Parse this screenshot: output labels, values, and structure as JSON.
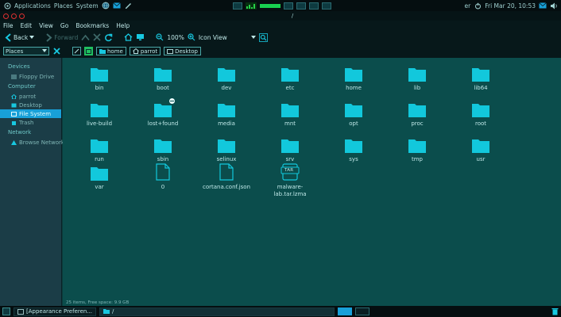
{
  "top_panel": {
    "applications": "Applications",
    "places": "Places",
    "system": "System",
    "user_short": "er",
    "datetime": "Fri Mar 20, 10:53"
  },
  "window": {
    "title": "/"
  },
  "menu": [
    "File",
    "Edit",
    "View",
    "Go",
    "Bookmarks",
    "Help"
  ],
  "toolbar": {
    "back": "Back",
    "forward": "Forward",
    "zoom": "100%",
    "view_mode": "Icon View"
  },
  "location": {
    "places_label": "Places",
    "crumbs": [
      "home",
      "parrot",
      "Desktop"
    ]
  },
  "sidebar": {
    "sections": [
      {
        "title": "Devices",
        "items": [
          {
            "label": "Floppy Drive",
            "icon": "floppy-icon",
            "active": false
          }
        ]
      },
      {
        "title": "Computer",
        "items": [
          {
            "label": "parrot",
            "icon": "home-icon",
            "active": false
          },
          {
            "label": "Desktop",
            "icon": "desktop-icon",
            "active": false
          },
          {
            "label": "File System",
            "icon": "drive-icon",
            "active": true
          },
          {
            "label": "Trash",
            "icon": "trash-icon",
            "active": false
          }
        ]
      },
      {
        "title": "Network",
        "items": [
          {
            "label": "Browse Network",
            "icon": "network-icon",
            "active": false
          }
        ]
      }
    ]
  },
  "files": [
    {
      "name": "bin",
      "type": "folder"
    },
    {
      "name": "boot",
      "type": "folder"
    },
    {
      "name": "dev",
      "type": "folder"
    },
    {
      "name": "etc",
      "type": "folder"
    },
    {
      "name": "home",
      "type": "folder"
    },
    {
      "name": "lib",
      "type": "folder"
    },
    {
      "name": "lib64",
      "type": "folder"
    },
    {
      "name": "live-build",
      "type": "folder"
    },
    {
      "name": "lost+found",
      "type": "folder",
      "badge": true
    },
    {
      "name": "media",
      "type": "folder"
    },
    {
      "name": "mnt",
      "type": "folder"
    },
    {
      "name": "opt",
      "type": "folder"
    },
    {
      "name": "proc",
      "type": "folder"
    },
    {
      "name": "root",
      "type": "folder"
    },
    {
      "name": "run",
      "type": "folder"
    },
    {
      "name": "sbin",
      "type": "folder"
    },
    {
      "name": "selinux",
      "type": "folder"
    },
    {
      "name": "srv",
      "type": "folder"
    },
    {
      "name": "sys",
      "type": "folder"
    },
    {
      "name": "tmp",
      "type": "folder"
    },
    {
      "name": "usr",
      "type": "folder"
    },
    {
      "name": "var",
      "type": "folder"
    },
    {
      "name": "0",
      "type": "file"
    },
    {
      "name": "cortana.conf.json",
      "type": "file"
    },
    {
      "name": "malware-lab.tar.lzma",
      "type": "archive",
      "badge_text": "TAR"
    }
  ],
  "status": "25 items, Free space: 9.9 GB",
  "taskbar": {
    "items": [
      {
        "label": "[Appearance Preferen...",
        "active": false
      },
      {
        "label": "/",
        "active": true
      }
    ]
  },
  "colors": {
    "accent": "#18a0d8",
    "folder": "#12c8dc",
    "background": "#0b4d4c"
  }
}
